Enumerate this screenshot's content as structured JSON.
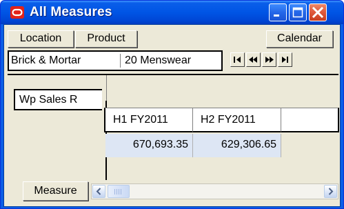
{
  "window": {
    "title": "All Measures",
    "icon": "oracle-logo-icon",
    "controls": [
      "minimize-icon",
      "maximize-icon",
      "close-icon"
    ]
  },
  "dimensions": {
    "location_label": "Location",
    "product_label": "Product",
    "calendar_label": "Calendar",
    "measure_label": "Measure"
  },
  "filter": {
    "location_value": "Brick & Mortar",
    "product_value": "20 Menswear",
    "nav_buttons": [
      "first-page-icon",
      "previous-page-icon",
      "next-page-icon",
      "last-page-icon"
    ]
  },
  "grid": {
    "columns": [
      "H1 FY2011",
      "H2 FY2011",
      ""
    ],
    "rows": [
      {
        "header": "Wp Sales R",
        "values": [
          "670,693.35",
          "629,306.65",
          ""
        ]
      }
    ]
  },
  "colors": {
    "titlebar": "#0055e5",
    "client": "#ece9d8",
    "cell_highlight": "#dde6f4",
    "close_button": "#e05b3d",
    "oracle_red": "#e2231a"
  }
}
